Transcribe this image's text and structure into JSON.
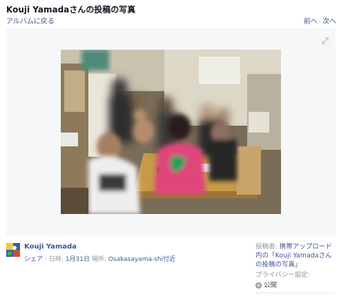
{
  "header": {
    "title": "Kouji Yamadaさんの投稿の写真",
    "back_label": "アルバムに戻る",
    "prev_label": "前へ",
    "separator": "·",
    "next_label": "次へ"
  },
  "viewer": {
    "expand_icon": "expand-icon",
    "photo_icon": "group-photo"
  },
  "post": {
    "author": "Kouji Yamada",
    "share_label": "シェア",
    "meta_separator": "·",
    "date_label": "日時:",
    "date_value": "1月31日",
    "place_label": "場所:",
    "place_value": "Osakasayama-shi付近"
  },
  "sidebar": {
    "poster_label": "投稿者:",
    "poster_value": "携帯アップロード内の「Kouji Yamadaさんの投稿の写真」",
    "privacy_label": "プライバシー設定:",
    "privacy_value": "公開",
    "privacy_icon": "globe-icon"
  },
  "colors": {
    "link": "#3b5998",
    "muted": "#90949c",
    "stage_bg": "#f6f7f9"
  }
}
